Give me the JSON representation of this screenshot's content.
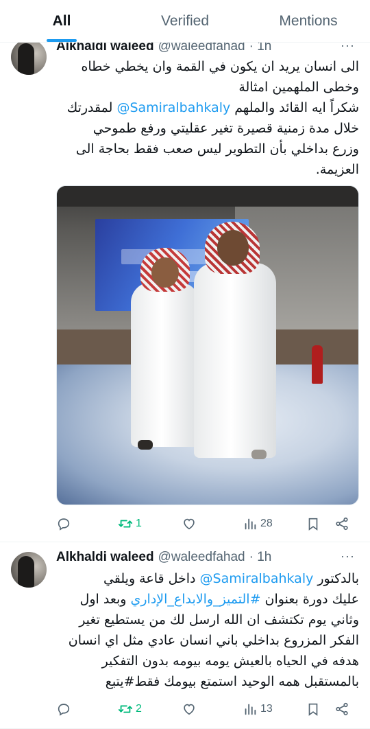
{
  "tabs": [
    {
      "label": "All"
    },
    {
      "label": "Verified"
    },
    {
      "label": "Mentions"
    }
  ],
  "tweets": [
    {
      "name": "Alkhaldi waleed",
      "handle": "@waleedfahad",
      "time": "· 1h",
      "lines": [
        "الى انسان يريد ان يكون في القمة وان يخطي خطاه",
        "وخطى الملهمين امثالة",
        {
          "pre": "شكراً ايه القائد والملهم ",
          "mention": "@Samiralbahkaly",
          "post": " لمقدرتك"
        },
        "خلال مدة زمنية قصيرة  تغير عقليتي ورفع طموحي",
        "وزرع بداخلي بأن التطوير ليس صعب فقط بحاجة الى",
        "العزيمة."
      ],
      "stats": {
        "replies": "",
        "retweets": "1",
        "likes": "",
        "views": "28"
      }
    },
    {
      "name": "Alkhaldi waleed",
      "handle": "@waleedfahad",
      "time": "· 1h",
      "lines": [
        {
          "pre": "بالدكتور ",
          "mention": "@Samiralbahkaly",
          "post": " داخل قاعة ويلقي"
        },
        {
          "pre": "عليك دورة بعنوان ",
          "hashtag": "#التميز_والابداع_الإداري",
          "post": " وبعد اول"
        },
        "وثاني يوم تكتشف ان الله ارسل لك من يستطيع تغير",
        "الفكر المزروع بداخلي باني انسان عادي مثل اي انسان",
        "هدفه في الحياه بالعيش يومه بيومه بدون التفكير",
        "بالمستقبل همه الوحيد استمتع بيومك فقط#يتبع"
      ],
      "stats": {
        "replies": "",
        "retweets": "2",
        "likes": "",
        "views": "13"
      }
    }
  ],
  "icons": {
    "reply": "reply-icon",
    "retweet": "retweet-icon",
    "like": "heart-icon",
    "views": "views-icon",
    "bookmark": "bookmark-icon",
    "share": "share-icon",
    "more": "more-icon"
  },
  "colors": {
    "accent": "#1d9bf0",
    "retweet": "#00ba7c",
    "muted": "#536471",
    "text": "#0f1419"
  }
}
